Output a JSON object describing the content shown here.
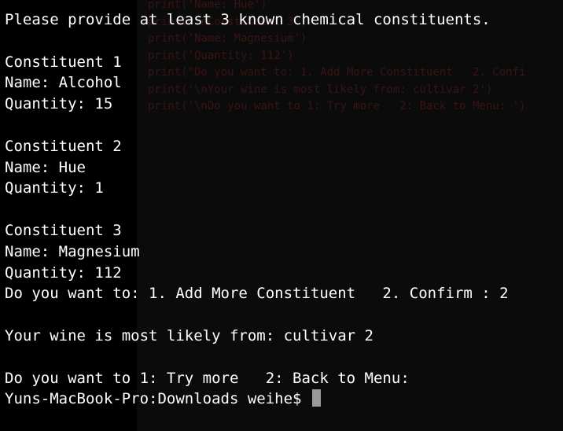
{
  "terminal": {
    "ghost_lines": [
      "print('Name: Hue')",
      "print('\\nConstituent 3')",
      "print('Name: Magnesium')",
      "print('Quantity: 112')",
      "print(\"Do you want to: 1. Add More Constituent   2. Confi",
      "print('\\nYour wine is most likely from: cultivar 2')",
      "print('\\nDo you want to 1: Try more   2: Back to Menu: ')"
    ],
    "lines": [
      "Please provide at least 3 known chemical constituents.",
      "",
      "Constituent 1",
      "Name: Alcohol",
      "Quantity: 15",
      "",
      "Constituent 2",
      "Name: Hue",
      "Quantity: 1",
      "",
      "Constituent 3",
      "Name: Magnesium",
      "Quantity: 112",
      "Do you want to: 1. Add More Constituent   2. Confirm : 2",
      "",
      "Your wine is most likely from: cultivar 2",
      "",
      "Do you want to 1: Try more   2: Back to Menu: "
    ],
    "prompt": "Yuns-MacBook-Pro:Downloads weihe$ ",
    "colors": {
      "background": "#000000",
      "text": "#ffffff",
      "cursor": "#9a9a9a"
    }
  }
}
